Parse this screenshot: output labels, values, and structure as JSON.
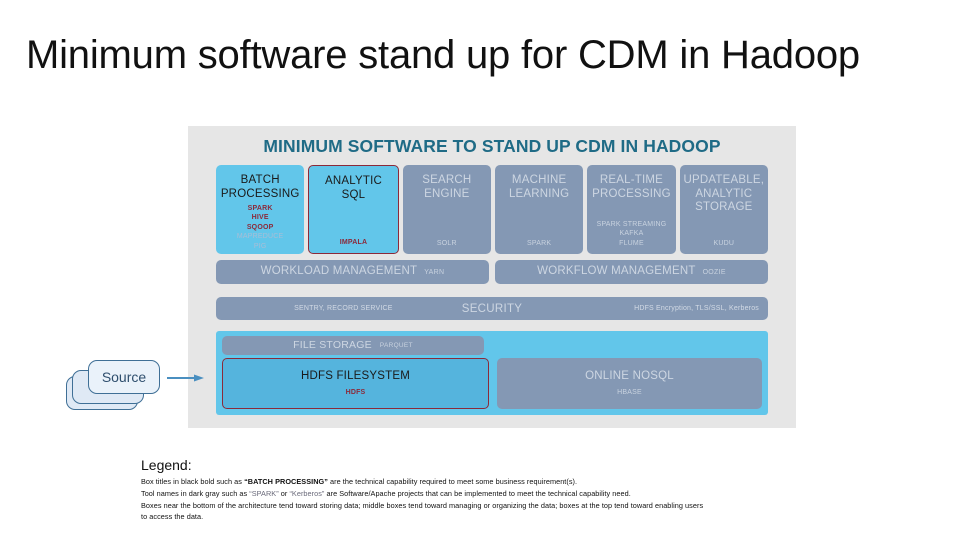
{
  "slide": {
    "title": "Minimum software stand up for CDM in Hadoop"
  },
  "diagram": {
    "heading": "MINIMUM SOFTWARE TO STAND UP CDM IN HADOOP",
    "capabilities": [
      {
        "title_line1": "BATCH",
        "title_line2": "PROCESSING",
        "style": "blue",
        "required_tools": [
          "SPARK",
          "HIVE",
          "SQOOP"
        ],
        "optional_tools": [
          "MAPREDUCE",
          "PIG"
        ]
      },
      {
        "title_line1": "ANALYTIC",
        "title_line2": "SQL",
        "style": "blue-outlined",
        "required_tools": [
          "IMPALA"
        ],
        "optional_tools": []
      },
      {
        "title_line1": "SEARCH",
        "title_line2": "ENGINE",
        "style": "gray",
        "required_tools": [],
        "optional_tools": [
          "SOLR"
        ]
      },
      {
        "title_line1": "MACHINE",
        "title_line2": "LEARNING",
        "style": "gray",
        "required_tools": [],
        "optional_tools": [
          "SPARK"
        ]
      },
      {
        "title_line1": "REAL-TIME",
        "title_line2": "PROCESSING",
        "style": "gray",
        "required_tools": [],
        "optional_tools": [
          "SPARK STREAMING",
          "KAFKA",
          "FLUME"
        ]
      },
      {
        "title_line1": "UPDATEABLE,",
        "title_line2": "ANALYTIC",
        "title_line3": "STORAGE",
        "style": "gray",
        "required_tools": [],
        "optional_tools": [
          "KUDU"
        ]
      }
    ],
    "management": [
      {
        "title": "WORKLOAD MANAGEMENT",
        "tool": "YARN"
      },
      {
        "title": "WORKFLOW MANAGEMENT",
        "tool": "OOZIE"
      }
    ],
    "security": {
      "left": "SENTRY, RECORD SERVICE",
      "title": "SECURITY",
      "right": "HDFS Encryption, TLS/SSL, Kerberos"
    },
    "file_storage": {
      "title": "FILE STORAGE",
      "tool": "PARQUET"
    },
    "storage": [
      {
        "title": "HDFS FILESYSTEM",
        "tool": "HDFS",
        "style": "blue-outlined"
      },
      {
        "title": "ONLINE NOSQL",
        "tool": "HBASE",
        "style": "gray"
      }
    ]
  },
  "source": {
    "label": "Source",
    "arrow_icon": "arrow-right-icon"
  },
  "legend": {
    "heading": "Legend:",
    "line1_pre": "Box titles in black bold such as ",
    "line1_quote": "“BATCH PROCESSING”",
    "line1_post": " are the technical capability required to meet some business requirement(s).",
    "line2_pre": "Tool names in dark gray such as ",
    "line2_quote1": "“SPARK”",
    "line2_mid": " or ",
    "line2_quote2": "“Kerberos”",
    "line2_post": " are Software/Apache projects that can be implemented to meet the technical capability need.",
    "line3": "Boxes near the bottom of the architecture tend toward storing data; middle boxes tend toward managing or organizing the data; boxes at the top tend toward enabling users",
    "line4": "to access the data."
  },
  "colors": {
    "panel_bg": "#e6e6e6",
    "heading": "#1f6b86",
    "blue_box": "#62c6ea",
    "gray_box": "#8498b4",
    "accent_red": "#8b2a3a",
    "source_border": "#3f6f96"
  }
}
